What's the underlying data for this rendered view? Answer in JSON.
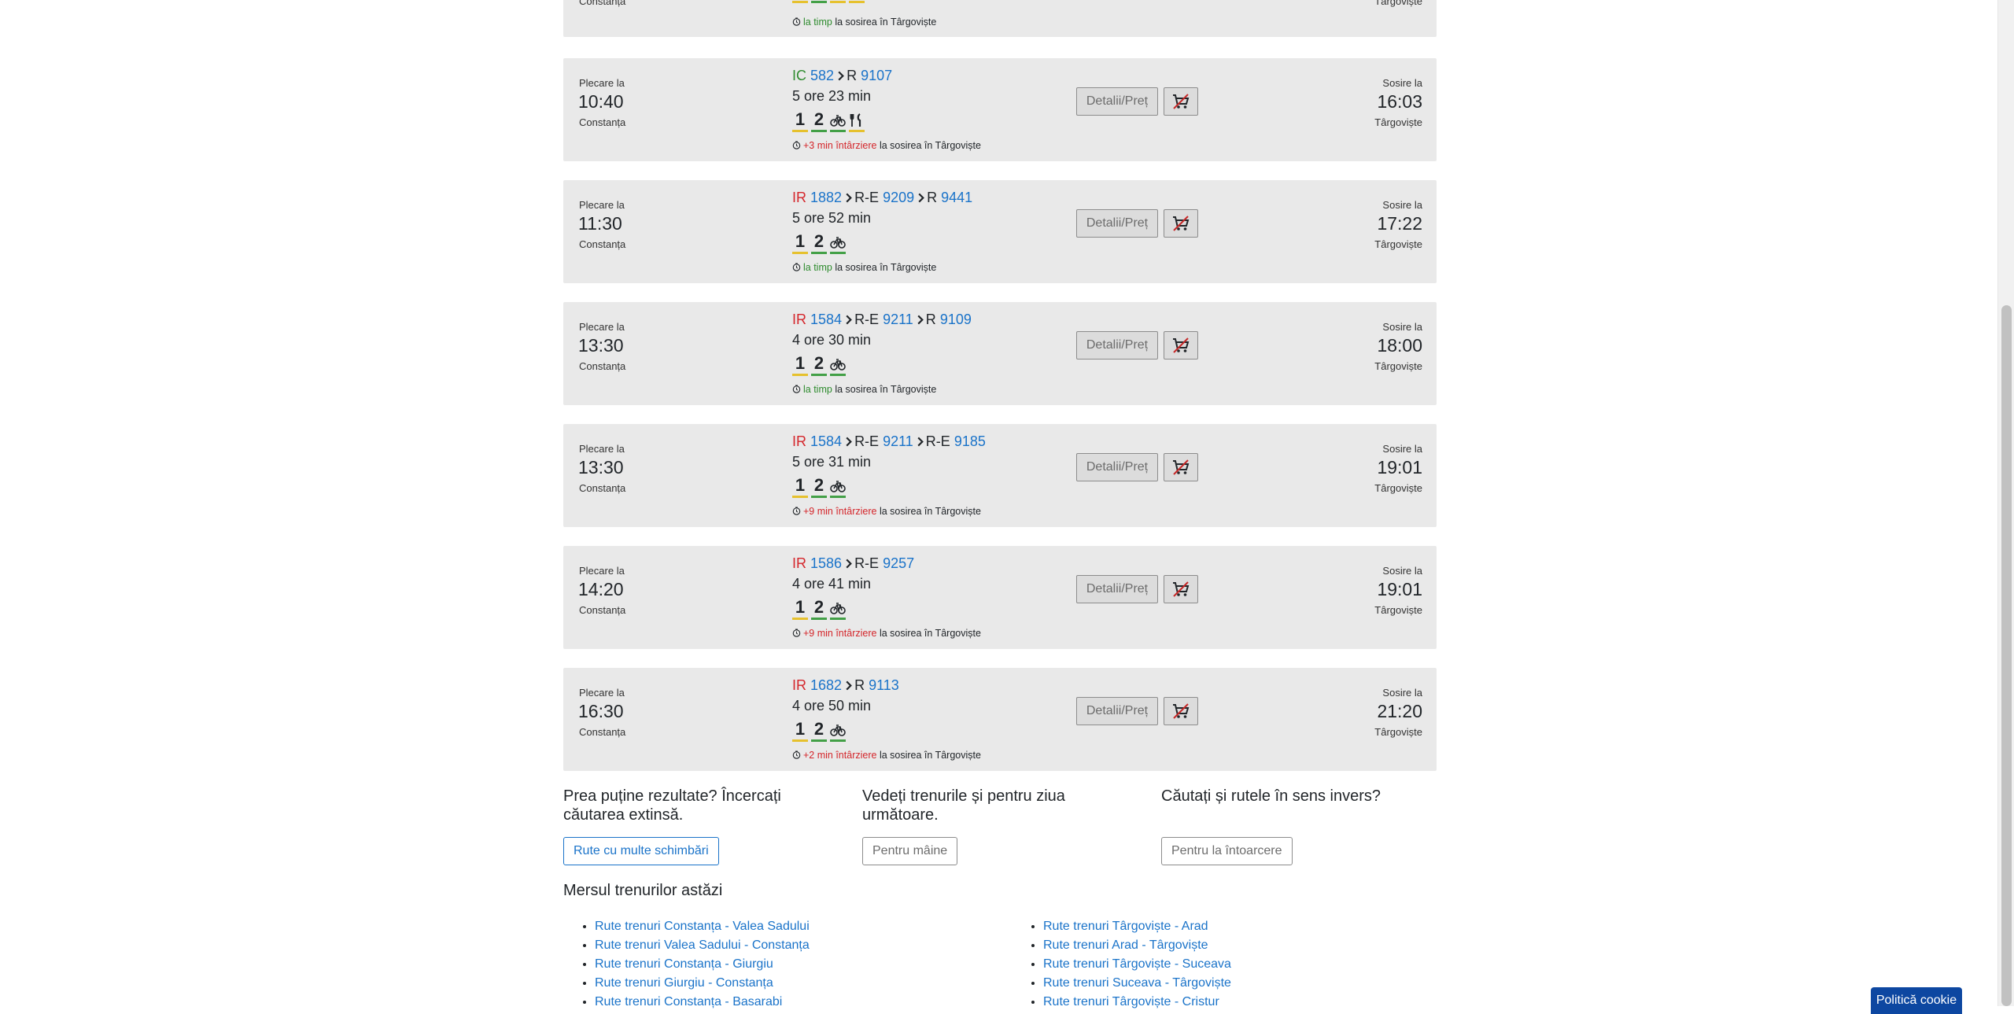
{
  "colors": {
    "link": "#1a73c9",
    "ir": "#d4262b",
    "ic": "#2e8b2e",
    "ontime": "#2e8b2e",
    "late": "#d4262b",
    "bar_yellow": "#e6c12e",
    "bar_green": "#43a047"
  },
  "top_partial": {
    "dep_station": "Constanța",
    "arr_station": "Târgoviște",
    "status_prefix": "la timp",
    "status_suffix": "la sosirea în Târgoviște"
  },
  "results": [
    {
      "dep_label": "Plecare la",
      "dep_time": "10:40",
      "dep_station": "Constanța",
      "trains": [
        {
          "cat": "IC",
          "num": "582"
        },
        {
          "cat": "R",
          "num": "9107"
        }
      ],
      "duration": "5 ore 23 min",
      "class1": "1",
      "class2": "2",
      "bike": "bicycle-icon",
      "restaurant": "fork-knife-icon",
      "status_prefix": "+3 min întârziere",
      "status_type": "late",
      "status_suffix": "la sosirea în Târgoviște",
      "details_label": "Detalii/Preț",
      "arr_label": "Sosire la",
      "arr_time": "16:03",
      "arr_station": "Târgoviște"
    },
    {
      "dep_label": "Plecare la",
      "dep_time": "11:30",
      "dep_station": "Constanța",
      "trains": [
        {
          "cat": "IR",
          "num": "1882"
        },
        {
          "cat": "R-E",
          "num": "9209"
        },
        {
          "cat": "R",
          "num": "9441"
        }
      ],
      "duration": "5 ore 52 min",
      "class1": "1",
      "class2": "2",
      "bike": "bicycle-icon",
      "status_prefix": "la timp",
      "status_type": "ontime",
      "status_suffix": "la sosirea în Târgoviște",
      "details_label": "Detalii/Preț",
      "arr_label": "Sosire la",
      "arr_time": "17:22",
      "arr_station": "Târgoviște"
    },
    {
      "dep_label": "Plecare la",
      "dep_time": "13:30",
      "dep_station": "Constanța",
      "trains": [
        {
          "cat": "IR",
          "num": "1584"
        },
        {
          "cat": "R-E",
          "num": "9211"
        },
        {
          "cat": "R",
          "num": "9109"
        }
      ],
      "duration": "4 ore 30 min",
      "class1": "1",
      "class2": "2",
      "bike": "bicycle-icon",
      "status_prefix": "la timp",
      "status_type": "ontime",
      "status_suffix": "la sosirea în Târgoviște",
      "details_label": "Detalii/Preț",
      "arr_label": "Sosire la",
      "arr_time": "18:00",
      "arr_station": "Târgoviște"
    },
    {
      "dep_label": "Plecare la",
      "dep_time": "13:30",
      "dep_station": "Constanța",
      "trains": [
        {
          "cat": "IR",
          "num": "1584"
        },
        {
          "cat": "R-E",
          "num": "9211"
        },
        {
          "cat": "R-E",
          "num": "9185"
        }
      ],
      "duration": "5 ore 31 min",
      "class1": "1",
      "class2": "2",
      "bike": "bicycle-icon",
      "status_prefix": "+9 min întârziere",
      "status_type": "late",
      "status_suffix": "la sosirea în Târgoviște",
      "details_label": "Detalii/Preț",
      "arr_label": "Sosire la",
      "arr_time": "19:01",
      "arr_station": "Târgoviște"
    },
    {
      "dep_label": "Plecare la",
      "dep_time": "14:20",
      "dep_station": "Constanța",
      "trains": [
        {
          "cat": "IR",
          "num": "1586"
        },
        {
          "cat": "R-E",
          "num": "9257"
        }
      ],
      "duration": "4 ore 41 min",
      "class1": "1",
      "class2": "2",
      "bike": "bicycle-icon",
      "status_prefix": "+9 min întârziere",
      "status_type": "late",
      "status_suffix": "la sosirea în Târgoviște",
      "details_label": "Detalii/Preț",
      "arr_label": "Sosire la",
      "arr_time": "19:01",
      "arr_station": "Târgoviște"
    },
    {
      "dep_label": "Plecare la",
      "dep_time": "16:30",
      "dep_station": "Constanța",
      "trains": [
        {
          "cat": "IR",
          "num": "1682"
        },
        {
          "cat": "R",
          "num": "9113"
        }
      ],
      "duration": "4 ore 50 min",
      "class1": "1",
      "class2": "2",
      "bike": "bicycle-icon",
      "status_prefix": "+2 min întârziere",
      "status_type": "late",
      "status_suffix": "la sosirea în Târgoviște",
      "details_label": "Detalii/Preț",
      "arr_label": "Sosire la",
      "arr_time": "21:20",
      "arr_station": "Târgoviște"
    }
  ],
  "suggestions": {
    "extended_question": "Prea puține rezultate? Încercați căutarea extinsă.",
    "extended_button": "Rute cu multe schimbări",
    "tomorrow_question": "Vedeți trenurile și pentru ziua următoare.",
    "tomorrow_button": "Pentru mâine",
    "return_question": "Căutați și rutele în sens invers?",
    "return_button": "Pentru la întoarcere"
  },
  "schedule": {
    "title": "Mersul trenurilor astăzi",
    "left_links": [
      "Rute trenuri Constanța - Valea Sadului",
      "Rute trenuri Valea Sadului - Constanța",
      "Rute trenuri Constanța - Giurgiu",
      "Rute trenuri Giurgiu - Constanța",
      "Rute trenuri Constanța - Basarabi"
    ],
    "right_links": [
      "Rute trenuri Târgoviște - Arad",
      "Rute trenuri Arad - Târgoviște",
      "Rute trenuri Târgoviște - Suceava",
      "Rute trenuri Suceava - Târgoviște",
      "Rute trenuri Târgoviște - Cristur"
    ]
  },
  "cookie": {
    "label": "Politică cookie"
  }
}
